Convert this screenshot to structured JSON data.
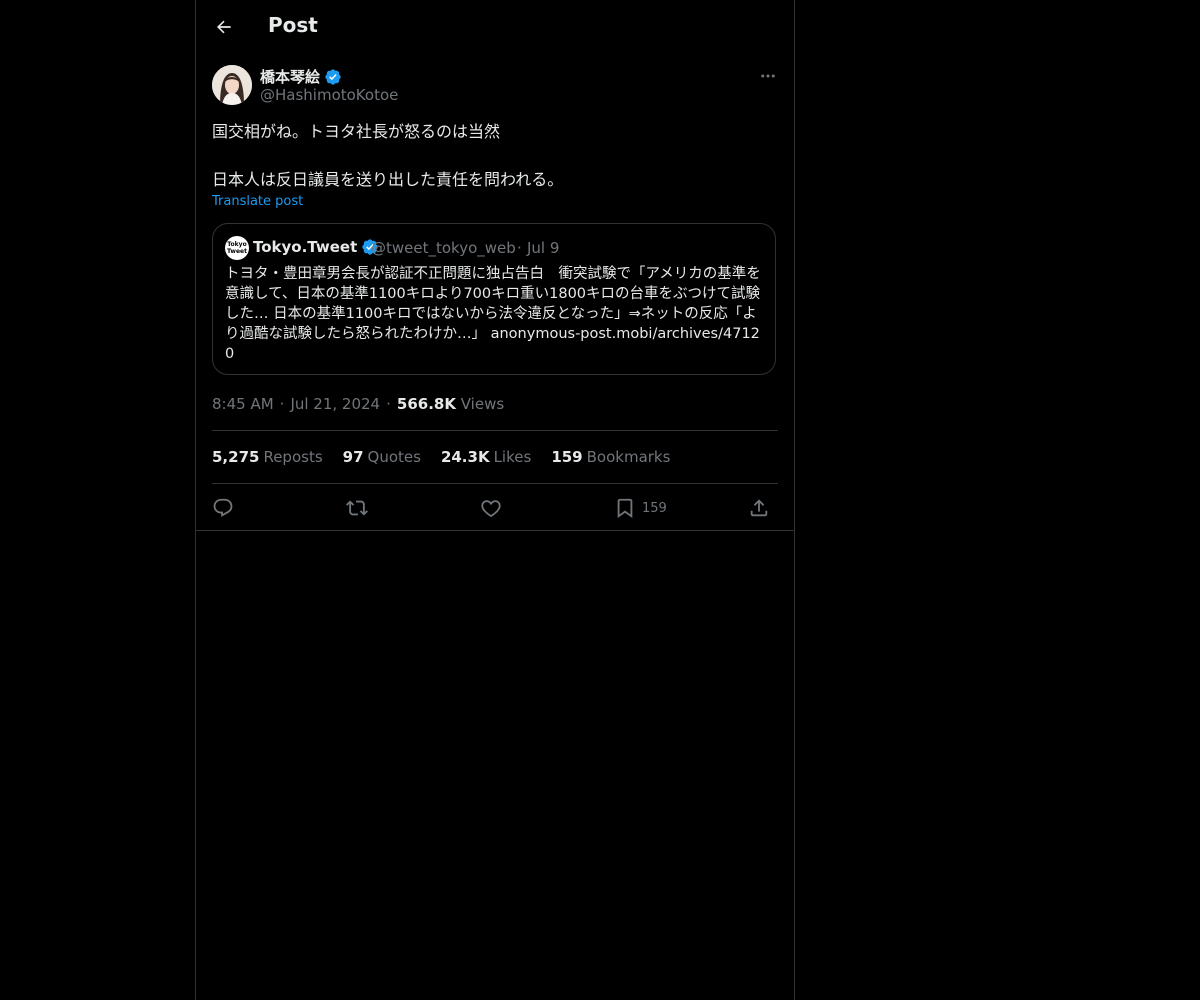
{
  "header": {
    "title": "Post"
  },
  "post": {
    "author_name": "橋本琴絵",
    "author_handle": "@HashimotoKotoe",
    "text": "国交相がね。トヨタ社長が怒るのは当然\n\n日本人は反日議員を送り出した責任を問われる。",
    "translate_label": "Translate post"
  },
  "quote": {
    "avatar_text": "Tokyo Tweet",
    "name": "Tokyo.Tweet",
    "handle": "@tweet_tokyo_web",
    "separator": "·",
    "date": "Jul 9",
    "text": "トヨタ・豊田章男会長が認証不正問題に独占告白　衝突試験で「アメリカの基準を意識して、日本の基準1100キロより700キロ重い1800キロの台車をぶつけて試験した… 日本の基準1100キロではないから法令違反となった」⇒ネットの反応「より過酷な試験したら怒られたわけか…」 anonymous-post.mobi/archives/47120"
  },
  "meta": {
    "time": "8:45 AM",
    "sep1": "·",
    "date": "Jul 21, 2024",
    "sep2": "·",
    "views_count": "566.8K",
    "views_label": "Views"
  },
  "stats": [
    {
      "count": "5,275",
      "label": "Reposts"
    },
    {
      "count": "97",
      "label": "Quotes"
    },
    {
      "count": "24.3K",
      "label": "Likes"
    },
    {
      "count": "159",
      "label": "Bookmarks"
    }
  ],
  "actions": {
    "bookmark_count": "159"
  },
  "icons": [
    "back-arrow-icon",
    "verified-badge-icon",
    "more-icon",
    "reply-icon",
    "repost-icon",
    "like-icon",
    "bookmark-icon",
    "share-icon"
  ],
  "colors": {
    "accent": "#1d9bf0",
    "muted": "#71767b",
    "text": "#e7e9ea",
    "border": "#2f3336",
    "background": "#000000"
  }
}
